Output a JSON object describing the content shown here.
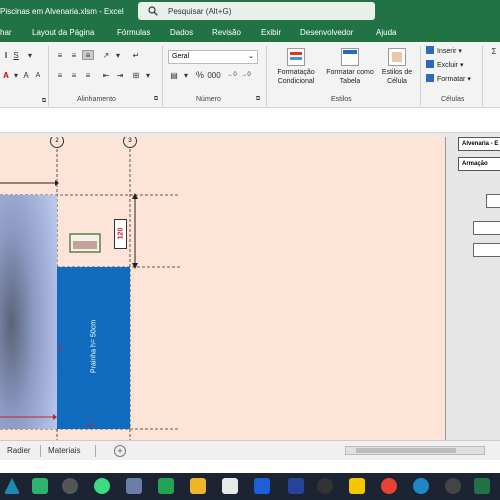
{
  "window": {
    "title": "Piscinas em Alvenaria.xlsm  -  Excel",
    "search_placeholder": "Pesquisar (Alt+G)"
  },
  "ribbon_tabs": [
    "har",
    "Layout da Página",
    "Fórmulas",
    "Dados",
    "Revisão",
    "Exibir",
    "Desenvolvedor",
    "Ajuda"
  ],
  "ribbon": {
    "number_format": "Geral",
    "groups": {
      "alignment": "Alinhamento",
      "number": "Número",
      "styles": "Estilos",
      "cells": "Células"
    },
    "styles_buttons": {
      "conditional": [
        "Formatação",
        "Condicional"
      ],
      "as_table": [
        "Formatar como",
        "Tabela"
      ],
      "cell_styles": [
        "Estilos de",
        "Célula"
      ]
    },
    "cells_buttons": {
      "insert": "Inserir",
      "delete": "Excluir",
      "format": "Formatar"
    }
  },
  "sheet": {
    "col_markers": [
      "2",
      "3"
    ],
    "dim_120": "120",
    "prainha_label": "Prainha h= 50cm"
  },
  "side_panel": {
    "labels": [
      "Alvenaria - E",
      "Armação"
    ]
  },
  "sheet_tabs": [
    "Radier",
    "Materiais"
  ],
  "colors": {
    "excel_green": "#217346",
    "sheet_bg": "#fde4d6",
    "prainha_blue": "#0f6cbf",
    "dimension_red": "#c8202a"
  },
  "taskbar_icons": [
    "triangle-app-icon",
    "green-app-icon",
    "chrome-dark-icon",
    "android-studio-icon",
    "photo-app-icon",
    "terminal-icon",
    "folder-icon",
    "board-icon",
    "blue-app-icon",
    "r-app-icon",
    "r-app-icon-2",
    "calc-app-icon",
    "sync-app-icon",
    "sticky-notes-icon",
    "chrome-icon",
    "edge-icon",
    "github-icon",
    "excel-icon"
  ]
}
